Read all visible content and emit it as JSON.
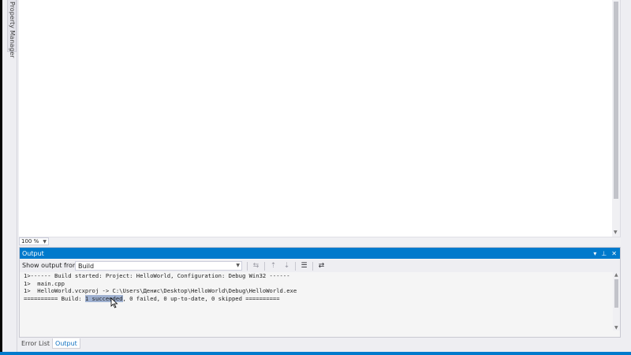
{
  "left_rail": {
    "property_manager_label": "Property Manager"
  },
  "editor": {
    "zoom": "100 %"
  },
  "output": {
    "title": "Output",
    "show_output_label": "Show output from:",
    "source": "Build",
    "lines_plain": [
      "1>------ Build started: Project: HelloWorld, Configuration: Debug Win32 ------",
      "1>  main.cpp",
      "1>  HelloWorld.vcxproj -> C:\\Users\\Денис\\Desktop\\HelloWorld\\Debug\\HelloWorld.exe"
    ],
    "summary_prefix": "========== Build: ",
    "summary_selected": "1 succeeded",
    "summary_suffix": ", 0 failed, 0 up-to-date, 0 skipped =========="
  },
  "bottom_tabs": [
    {
      "label": "Error List"
    },
    {
      "label": "Output"
    }
  ],
  "colors": {
    "accent": "#007acc",
    "selection": "#9fb1d1",
    "panel_bg": "#eeeef2"
  }
}
